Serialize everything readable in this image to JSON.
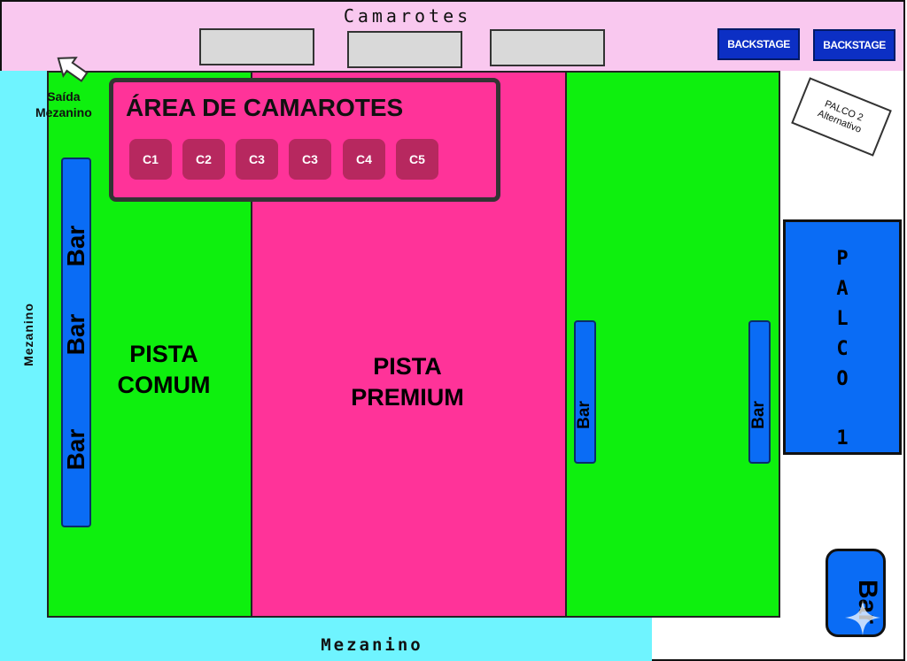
{
  "title": "Camarotes",
  "backstage": [
    "BACKSTAGE",
    "BACKSTAGE"
  ],
  "mezanino_left": "Mezanino",
  "mezanino_bottom": "Mezanino",
  "saida": {
    "line1": "Saída",
    "line2": "Mezanino"
  },
  "area_camarotes": {
    "title": "ÁREA DE CAMAROTES",
    "boxes": [
      "C1",
      "C2",
      "C3",
      "C3",
      "C4",
      "C5"
    ]
  },
  "pista_comum": {
    "line1": "PISTA",
    "line2": "COMUM"
  },
  "pista_premium": {
    "line1": "PISTA",
    "line2": "PREMIUM"
  },
  "bars": {
    "left_top": "Bar",
    "left_mid": "Bar",
    "left_bottom": "Bar",
    "right_a": "Bar",
    "right_b": "Bar",
    "corner": "Bar"
  },
  "palco1": {
    "letters": [
      "P",
      "A",
      "L",
      "C",
      "O"
    ],
    "number": "1"
  },
  "palco2": {
    "line1": "PALCO 2",
    "line2": "Alternativo"
  },
  "colors": {
    "pink": "#ff3399",
    "green": "#0ef00e",
    "cyan": "#6ff4ff",
    "blue": "#0a6cf5",
    "lightpink": "#f9c8ef"
  }
}
